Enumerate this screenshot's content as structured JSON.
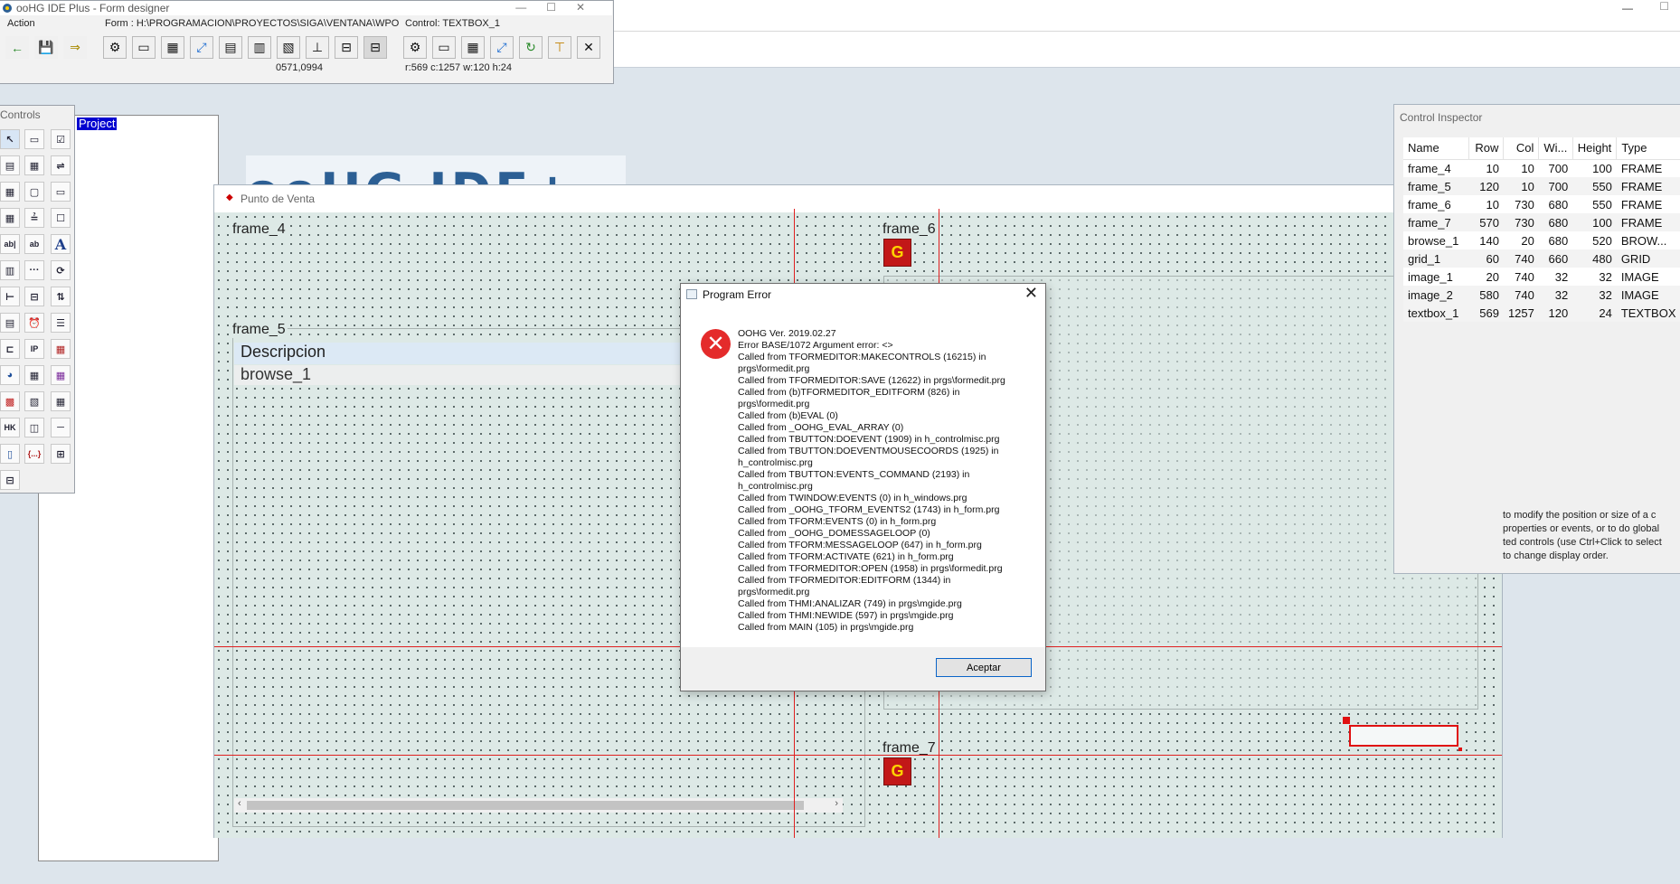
{
  "main_window": {
    "min_glyph": "—",
    "max_glyph": "☐"
  },
  "form_designer": {
    "title": "ooHG IDE Plus - Form designer",
    "action_label": "Action",
    "form_path": "Form : H:\\PROGRAMACION\\PROYECTOS\\SIGA\\VENTANA\\WPO",
    "control_label": "Control: TEXTBOX_1",
    "cursor_pos": "0571,0994",
    "control_geom": "r:569 c:1257 w:120 h:24",
    "buttons": [
      "←",
      "💾",
      "⇒",
      "⚙",
      "▭",
      "▦",
      "⤢",
      "▤",
      "▥",
      "▧",
      "⊥",
      "⊟",
      "⊟",
      "⚙",
      "▭",
      "▦",
      "⤢",
      "↻",
      "⊤",
      "✕"
    ]
  },
  "controls_palette": {
    "title": "Controls",
    "items": [
      "↖",
      "▭",
      "☑",
      "▤",
      "▦",
      "⇌",
      "▦",
      "▢",
      "▭",
      "▦",
      "≟",
      "☐",
      "ab|",
      "ab",
      "A",
      "▥",
      "···",
      "⟳",
      "⊢",
      "⊟",
      "⇅",
      "▤",
      "⏰",
      "☰",
      "⊏",
      "IP",
      "▦",
      "◕",
      "▦",
      "▦",
      "▩",
      "▧",
      "▦",
      "HK",
      "◫",
      "─",
      "▯",
      "{...}",
      "⊞",
      "⊟"
    ]
  },
  "project_panel": {
    "item": "Project"
  },
  "logo_strip": {
    "text": "ooHG IDE+"
  },
  "form_window": {
    "title": "Punto de Venta",
    "close": "✕",
    "frames": [
      "frame_4",
      "frame_5",
      "frame_6",
      "frame_7"
    ],
    "browse": {
      "header": "Descripcion",
      "row": "browse_1"
    }
  },
  "control_inspector": {
    "title": "Control Inspector",
    "columns": [
      "Name",
      "Row",
      "Col",
      "Wi...",
      "Height",
      "Type"
    ],
    "rows": [
      {
        "name": "frame_4",
        "row": "10",
        "col": "10",
        "width": "700",
        "height": "100",
        "type": "FRAME"
      },
      {
        "name": "frame_5",
        "row": "120",
        "col": "10",
        "width": "700",
        "height": "550",
        "type": "FRAME"
      },
      {
        "name": "frame_6",
        "row": "10",
        "col": "730",
        "width": "680",
        "height": "550",
        "type": "FRAME"
      },
      {
        "name": "frame_7",
        "row": "570",
        "col": "730",
        "width": "680",
        "height": "100",
        "type": "FRAME"
      },
      {
        "name": "browse_1",
        "row": "140",
        "col": "20",
        "width": "680",
        "height": "520",
        "type": "BROW..."
      },
      {
        "name": "grid_1",
        "row": "60",
        "col": "740",
        "width": "660",
        "height": "480",
        "type": "GRID"
      },
      {
        "name": "image_1",
        "row": "20",
        "col": "740",
        "width": "32",
        "height": "32",
        "type": "IMAGE"
      },
      {
        "name": "image_2",
        "row": "580",
        "col": "740",
        "width": "32",
        "height": "32",
        "type": "IMAGE"
      },
      {
        "name": "textbox_1",
        "row": "569",
        "col": "1257",
        "width": "120",
        "height": "24",
        "type": "TEXTBOX"
      }
    ],
    "help": [
      "to modify the position or size of a c",
      "properties or events, or to do global",
      "ted controls (use Ctrl+Click to select",
      "to change display order."
    ]
  },
  "error_dialog": {
    "title": "Program Error",
    "close": "✕",
    "icon": "✕",
    "lines": [
      "OOHG Ver. 2019.02.27",
      "Error BASE/1072  Argument error: <>",
      "Called from TFORMEDITOR:MAKECONTROLS (16215) in",
      "prgs\\formedit.prg",
      "Called from TFORMEDITOR:SAVE (12622) in prgs\\formedit.prg",
      "Called from (b)TFORMEDITOR_EDITFORM (826) in",
      "prgs\\formedit.prg",
      "Called from (b)EVAL (0)",
      "Called from _OOHG_EVAL_ARRAY (0)",
      "Called from TBUTTON:DOEVENT (1909) in h_controlmisc.prg",
      "Called from TBUTTON:DOEVENTMOUSECOORDS (1925) in",
      "h_controlmisc.prg",
      "Called from TBUTTON:EVENTS_COMMAND (2193) in",
      "h_controlmisc.prg",
      "Called from TWINDOW:EVENTS (0) in h_windows.prg",
      "Called from _OOHG_TFORM_EVENTS2 (1743) in h_form.prg",
      "Called from TFORM:EVENTS (0) in h_form.prg",
      "Called from _OOHG_DOMESSAGELOOP (0)",
      "Called from TFORM:MESSAGELOOP (647) in h_form.prg",
      "Called from TFORM:ACTIVATE (621) in h_form.prg",
      "Called from TFORMEDITOR:OPEN (1958) in prgs\\formedit.prg",
      "Called from TFORMEDITOR:EDITFORM (1344) in",
      "prgs\\formedit.prg",
      "Called from THMI:ANALIZAR (749) in prgs\\mgide.prg",
      "Called from THMI:NEWIDE (597) in prgs\\mgide.prg",
      "Called from MAIN (105) in prgs\\mgide.prg"
    ],
    "ok_label": "Aceptar"
  }
}
